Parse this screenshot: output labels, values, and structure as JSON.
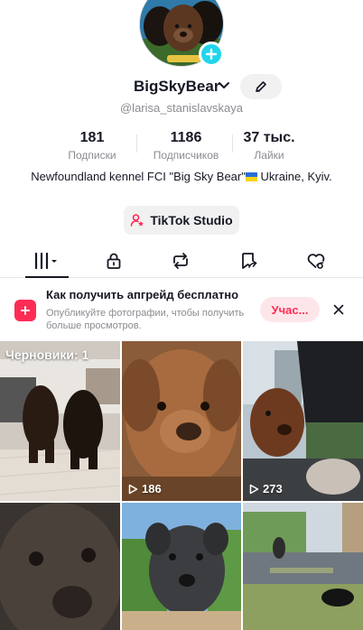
{
  "profile": {
    "username": "BigSkyBear",
    "handle": "@larisa_stanislavskaya",
    "bio_text": "Newfoundland kennel FCI  \"Big Sky Bear\"",
    "bio_location": " Ukraine, Kyiv."
  },
  "stats": [
    {
      "value": "181",
      "label": "Подписки"
    },
    {
      "value": "1186",
      "label": "Подписчиков"
    },
    {
      "value": "37 тыс.",
      "label": "Лайки"
    }
  ],
  "studio_button": "TikTok Studio",
  "tabs": [
    {
      "icon": "videos-grid-icon",
      "active": true
    },
    {
      "icon": "lock-icon"
    },
    {
      "icon": "repost-icon"
    },
    {
      "icon": "favorites-icon"
    },
    {
      "icon": "liked-heart-icon"
    }
  ],
  "promo": {
    "title": "Как получить апгрейд бесплатно",
    "subtitle": "Опубликуйте фотографии, чтобы получить больше просмотров.",
    "cta": "Учас..."
  },
  "grid": {
    "drafts_label": "Черновики: 1",
    "videos": [
      {
        "views": "186"
      },
      {
        "views": "273"
      }
    ]
  },
  "colors": {
    "accent": "#fe2c55",
    "add_button": "#20d5ec",
    "text_primary": "#161823",
    "text_secondary": "#8a8b91"
  }
}
